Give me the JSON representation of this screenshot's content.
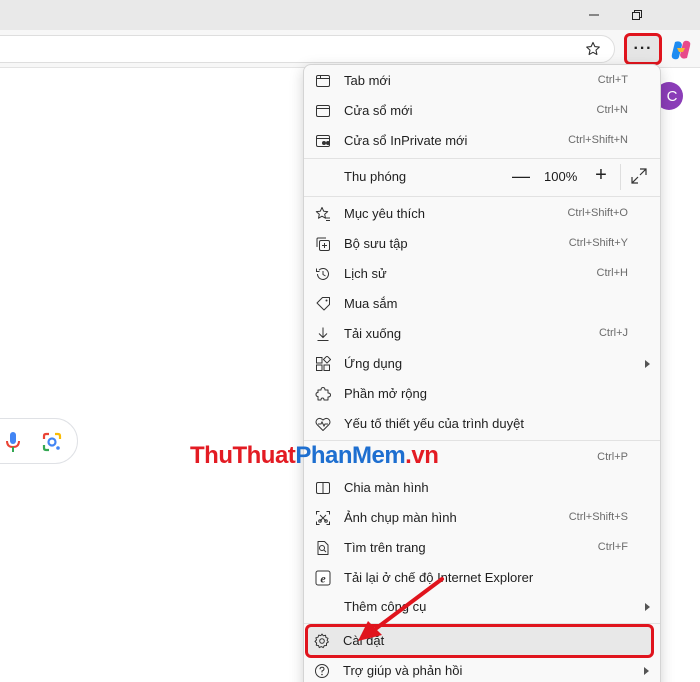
{
  "menu": {
    "items": [
      {
        "label": "Tab mới",
        "shortcut": "Ctrl+T"
      },
      {
        "label": "Cửa sổ mới",
        "shortcut": "Ctrl+N"
      },
      {
        "label": "Cửa sổ InPrivate mới",
        "shortcut": "Ctrl+Shift+N"
      },
      {
        "label": "Mục yêu thích",
        "shortcut": "Ctrl+Shift+O"
      },
      {
        "label": "Bộ sưu tập",
        "shortcut": "Ctrl+Shift+Y"
      },
      {
        "label": "Lịch sử",
        "shortcut": "Ctrl+H"
      },
      {
        "label": "Mua sắm",
        "shortcut": ""
      },
      {
        "label": "Tải xuống",
        "shortcut": "Ctrl+J"
      },
      {
        "label": "Ứng dụng",
        "shortcut": ""
      },
      {
        "label": "Phần mở rộng",
        "shortcut": ""
      },
      {
        "label": "Yếu tố thiết yếu của trình duyệt",
        "shortcut": ""
      },
      {
        "label": "",
        "shortcut": "Ctrl+P"
      },
      {
        "label": "Chia màn hình",
        "shortcut": ""
      },
      {
        "label": "Ảnh chụp màn hình",
        "shortcut": "Ctrl+Shift+S"
      },
      {
        "label": "Tìm trên trang",
        "shortcut": "Ctrl+F"
      },
      {
        "label": "Tải lại ở chế độ Internet Explorer",
        "shortcut": ""
      },
      {
        "label": "Thêm công cụ",
        "shortcut": ""
      },
      {
        "label": "Cài đặt",
        "shortcut": ""
      },
      {
        "label": "Trợ giúp và phản hồi",
        "shortcut": ""
      }
    ],
    "zoom": {
      "label": "Thu phóng",
      "value": "100%",
      "minus": "—",
      "plus": "+"
    }
  },
  "toolbar": {
    "more_label": "···"
  },
  "profile": {
    "initial": "C"
  },
  "watermark": {
    "part1": "ThuThuat",
    "part2": "PhanMem",
    "part3": ".vn"
  },
  "colors": {
    "highlight": "#e0141d",
    "avatar": "#8b3db8",
    "watermark_red": "#e31b23",
    "watermark_blue": "#1e6fd0"
  },
  "icons": [
    "new-tab-icon",
    "new-window-icon",
    "inprivate-icon",
    "favorites-icon",
    "collections-icon",
    "history-icon",
    "shopping-icon",
    "download-icon",
    "apps-icon",
    "extensions-icon",
    "browser-essentials-icon",
    "split-screen-icon",
    "screenshot-icon",
    "find-icon",
    "ie-mode-icon",
    "settings-icon",
    "help-icon"
  ]
}
